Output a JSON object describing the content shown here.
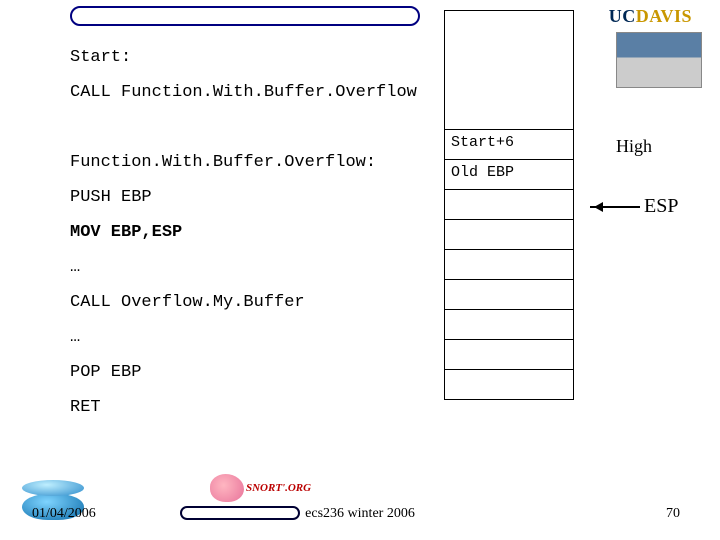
{
  "logo": {
    "uc": "UC",
    "davis": "DAVIS"
  },
  "code_lines": {
    "l0": "Start:",
    "l1": "CALL Function.With.Buffer.Overflow",
    "spacer": " ",
    "l2": "Function.With.Buffer.Overflow:",
    "l3": "PUSH EBP",
    "l4": "MOV EBP,ESP",
    "l5": "…",
    "l6": "CALL Overflow.My.Buffer",
    "l7": "…",
    "l8": "POP EBP",
    "l9": "RET"
  },
  "stack": {
    "cells": [
      "",
      "Start+6",
      "Old EBP",
      "",
      "",
      "",
      "",
      "",
      "",
      ""
    ]
  },
  "labels": {
    "high": "High",
    "esp": "ESP"
  },
  "snort_label": "SNORT'.ORG",
  "footer": {
    "date": "01/04/2006",
    "center": "ecs236 winter 2006",
    "page": "70"
  }
}
